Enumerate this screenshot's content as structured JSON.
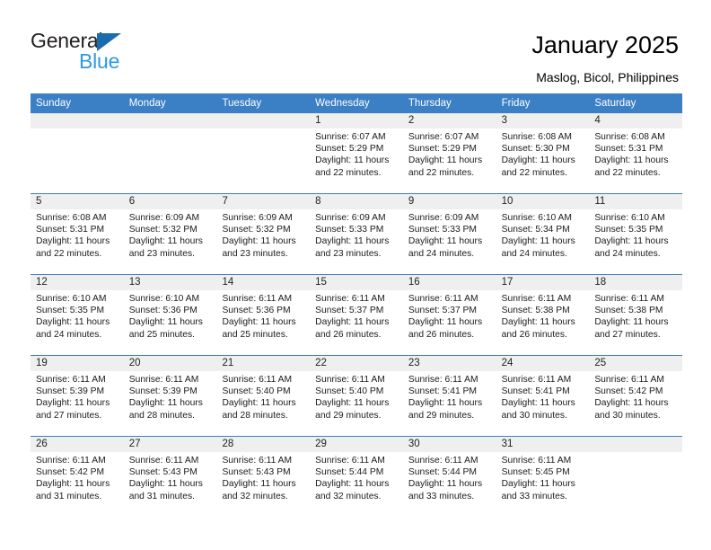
{
  "brand": {
    "name_dark": "General",
    "name_blue": "Blue",
    "accent_blue": "#3b7fc4",
    "logo_blue": "#2d9ae2",
    "logo_triangle_blue": "#1b6bb0"
  },
  "header": {
    "title": "January 2025",
    "subtitle": "Maslog, Bicol, Philippines"
  },
  "weekdays": [
    "Sunday",
    "Monday",
    "Tuesday",
    "Wednesday",
    "Thursday",
    "Friday",
    "Saturday"
  ],
  "labels": {
    "sunrise_prefix": "Sunrise:",
    "sunset_prefix": "Sunset:",
    "daylight_prefix": "Daylight:"
  },
  "weeks": [
    [
      {
        "day": "",
        "empty": true,
        "sunrise": "",
        "sunset": "",
        "daylight_line1": "",
        "daylight_line2": ""
      },
      {
        "day": "",
        "empty": true,
        "sunrise": "",
        "sunset": "",
        "daylight_line1": "",
        "daylight_line2": ""
      },
      {
        "day": "",
        "empty": true,
        "sunrise": "",
        "sunset": "",
        "daylight_line1": "",
        "daylight_line2": ""
      },
      {
        "day": "1",
        "empty": false,
        "sunrise": "Sunrise: 6:07 AM",
        "sunset": "Sunset: 5:29 PM",
        "daylight_line1": "Daylight: 11 hours",
        "daylight_line2": "and 22 minutes."
      },
      {
        "day": "2",
        "empty": false,
        "sunrise": "Sunrise: 6:07 AM",
        "sunset": "Sunset: 5:29 PM",
        "daylight_line1": "Daylight: 11 hours",
        "daylight_line2": "and 22 minutes."
      },
      {
        "day": "3",
        "empty": false,
        "sunrise": "Sunrise: 6:08 AM",
        "sunset": "Sunset: 5:30 PM",
        "daylight_line1": "Daylight: 11 hours",
        "daylight_line2": "and 22 minutes."
      },
      {
        "day": "4",
        "empty": false,
        "sunrise": "Sunrise: 6:08 AM",
        "sunset": "Sunset: 5:31 PM",
        "daylight_line1": "Daylight: 11 hours",
        "daylight_line2": "and 22 minutes."
      }
    ],
    [
      {
        "day": "5",
        "empty": false,
        "sunrise": "Sunrise: 6:08 AM",
        "sunset": "Sunset: 5:31 PM",
        "daylight_line1": "Daylight: 11 hours",
        "daylight_line2": "and 22 minutes."
      },
      {
        "day": "6",
        "empty": false,
        "sunrise": "Sunrise: 6:09 AM",
        "sunset": "Sunset: 5:32 PM",
        "daylight_line1": "Daylight: 11 hours",
        "daylight_line2": "and 23 minutes."
      },
      {
        "day": "7",
        "empty": false,
        "sunrise": "Sunrise: 6:09 AM",
        "sunset": "Sunset: 5:32 PM",
        "daylight_line1": "Daylight: 11 hours",
        "daylight_line2": "and 23 minutes."
      },
      {
        "day": "8",
        "empty": false,
        "sunrise": "Sunrise: 6:09 AM",
        "sunset": "Sunset: 5:33 PM",
        "daylight_line1": "Daylight: 11 hours",
        "daylight_line2": "and 23 minutes."
      },
      {
        "day": "9",
        "empty": false,
        "sunrise": "Sunrise: 6:09 AM",
        "sunset": "Sunset: 5:33 PM",
        "daylight_line1": "Daylight: 11 hours",
        "daylight_line2": "and 24 minutes."
      },
      {
        "day": "10",
        "empty": false,
        "sunrise": "Sunrise: 6:10 AM",
        "sunset": "Sunset: 5:34 PM",
        "daylight_line1": "Daylight: 11 hours",
        "daylight_line2": "and 24 minutes."
      },
      {
        "day": "11",
        "empty": false,
        "sunrise": "Sunrise: 6:10 AM",
        "sunset": "Sunset: 5:35 PM",
        "daylight_line1": "Daylight: 11 hours",
        "daylight_line2": "and 24 minutes."
      }
    ],
    [
      {
        "day": "12",
        "empty": false,
        "sunrise": "Sunrise: 6:10 AM",
        "sunset": "Sunset: 5:35 PM",
        "daylight_line1": "Daylight: 11 hours",
        "daylight_line2": "and 24 minutes."
      },
      {
        "day": "13",
        "empty": false,
        "sunrise": "Sunrise: 6:10 AM",
        "sunset": "Sunset: 5:36 PM",
        "daylight_line1": "Daylight: 11 hours",
        "daylight_line2": "and 25 minutes."
      },
      {
        "day": "14",
        "empty": false,
        "sunrise": "Sunrise: 6:11 AM",
        "sunset": "Sunset: 5:36 PM",
        "daylight_line1": "Daylight: 11 hours",
        "daylight_line2": "and 25 minutes."
      },
      {
        "day": "15",
        "empty": false,
        "sunrise": "Sunrise: 6:11 AM",
        "sunset": "Sunset: 5:37 PM",
        "daylight_line1": "Daylight: 11 hours",
        "daylight_line2": "and 26 minutes."
      },
      {
        "day": "16",
        "empty": false,
        "sunrise": "Sunrise: 6:11 AM",
        "sunset": "Sunset: 5:37 PM",
        "daylight_line1": "Daylight: 11 hours",
        "daylight_line2": "and 26 minutes."
      },
      {
        "day": "17",
        "empty": false,
        "sunrise": "Sunrise: 6:11 AM",
        "sunset": "Sunset: 5:38 PM",
        "daylight_line1": "Daylight: 11 hours",
        "daylight_line2": "and 26 minutes."
      },
      {
        "day": "18",
        "empty": false,
        "sunrise": "Sunrise: 6:11 AM",
        "sunset": "Sunset: 5:38 PM",
        "daylight_line1": "Daylight: 11 hours",
        "daylight_line2": "and 27 minutes."
      }
    ],
    [
      {
        "day": "19",
        "empty": false,
        "sunrise": "Sunrise: 6:11 AM",
        "sunset": "Sunset: 5:39 PM",
        "daylight_line1": "Daylight: 11 hours",
        "daylight_line2": "and 27 minutes."
      },
      {
        "day": "20",
        "empty": false,
        "sunrise": "Sunrise: 6:11 AM",
        "sunset": "Sunset: 5:39 PM",
        "daylight_line1": "Daylight: 11 hours",
        "daylight_line2": "and 28 minutes."
      },
      {
        "day": "21",
        "empty": false,
        "sunrise": "Sunrise: 6:11 AM",
        "sunset": "Sunset: 5:40 PM",
        "daylight_line1": "Daylight: 11 hours",
        "daylight_line2": "and 28 minutes."
      },
      {
        "day": "22",
        "empty": false,
        "sunrise": "Sunrise: 6:11 AM",
        "sunset": "Sunset: 5:40 PM",
        "daylight_line1": "Daylight: 11 hours",
        "daylight_line2": "and 29 minutes."
      },
      {
        "day": "23",
        "empty": false,
        "sunrise": "Sunrise: 6:11 AM",
        "sunset": "Sunset: 5:41 PM",
        "daylight_line1": "Daylight: 11 hours",
        "daylight_line2": "and 29 minutes."
      },
      {
        "day": "24",
        "empty": false,
        "sunrise": "Sunrise: 6:11 AM",
        "sunset": "Sunset: 5:41 PM",
        "daylight_line1": "Daylight: 11 hours",
        "daylight_line2": "and 30 minutes."
      },
      {
        "day": "25",
        "empty": false,
        "sunrise": "Sunrise: 6:11 AM",
        "sunset": "Sunset: 5:42 PM",
        "daylight_line1": "Daylight: 11 hours",
        "daylight_line2": "and 30 minutes."
      }
    ],
    [
      {
        "day": "26",
        "empty": false,
        "sunrise": "Sunrise: 6:11 AM",
        "sunset": "Sunset: 5:42 PM",
        "daylight_line1": "Daylight: 11 hours",
        "daylight_line2": "and 31 minutes."
      },
      {
        "day": "27",
        "empty": false,
        "sunrise": "Sunrise: 6:11 AM",
        "sunset": "Sunset: 5:43 PM",
        "daylight_line1": "Daylight: 11 hours",
        "daylight_line2": "and 31 minutes."
      },
      {
        "day": "28",
        "empty": false,
        "sunrise": "Sunrise: 6:11 AM",
        "sunset": "Sunset: 5:43 PM",
        "daylight_line1": "Daylight: 11 hours",
        "daylight_line2": "and 32 minutes."
      },
      {
        "day": "29",
        "empty": false,
        "sunrise": "Sunrise: 6:11 AM",
        "sunset": "Sunset: 5:44 PM",
        "daylight_line1": "Daylight: 11 hours",
        "daylight_line2": "and 32 minutes."
      },
      {
        "day": "30",
        "empty": false,
        "sunrise": "Sunrise: 6:11 AM",
        "sunset": "Sunset: 5:44 PM",
        "daylight_line1": "Daylight: 11 hours",
        "daylight_line2": "and 33 minutes."
      },
      {
        "day": "31",
        "empty": false,
        "sunrise": "Sunrise: 6:11 AM",
        "sunset": "Sunset: 5:45 PM",
        "daylight_line1": "Daylight: 11 hours",
        "daylight_line2": "and 33 minutes."
      },
      {
        "day": "",
        "empty": true,
        "sunrise": "",
        "sunset": "",
        "daylight_line1": "",
        "daylight_line2": ""
      }
    ]
  ]
}
